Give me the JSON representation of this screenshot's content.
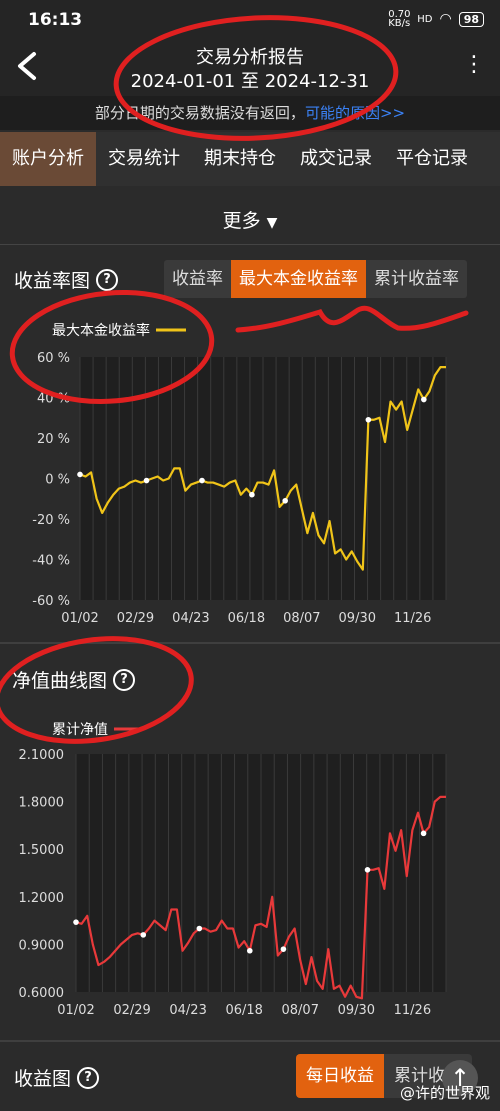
{
  "status": {
    "time": "16:13",
    "net": "0.70 KB/s",
    "signal": "HD",
    "battery": "98"
  },
  "header": {
    "title": "交易分析报告",
    "subtitle": "2024-01-01 至 2024-12-31"
  },
  "notice": {
    "text_before": "部分日期的交易数据没有返回，",
    "link": "可能的原因>>"
  },
  "tabs": [
    {
      "label": "账户分析",
      "active": true
    },
    {
      "label": "交易统计",
      "active": false
    },
    {
      "label": "期末持仓",
      "active": false
    },
    {
      "label": "成交记录",
      "active": false
    },
    {
      "label": "平仓记录",
      "active": false
    }
  ],
  "more": {
    "label": "更多"
  },
  "return_chart": {
    "title": "收益率图",
    "options": [
      {
        "label": "收益率",
        "active": false
      },
      {
        "label": "最大本金收益率",
        "active": true
      },
      {
        "label": "累计收益率",
        "active": false
      }
    ]
  },
  "nav_chart": {
    "title": "净值曲线图"
  },
  "profit_chart": {
    "title": "收益图",
    "options": [
      {
        "label": "每日收益",
        "active": true
      },
      {
        "label": "累计收益",
        "active": false
      }
    ]
  },
  "watermark": "@许的世界观",
  "chart_data": [
    {
      "type": "line",
      "title": "",
      "legend": [
        "最大本金收益率"
      ],
      "ylim": [
        -60,
        60
      ],
      "yticks": [
        "-60 %",
        "-40 %",
        "-20 %",
        "0 %",
        "20 %",
        "40 %",
        "60 %"
      ],
      "xticks": [
        "01/02",
        "02/29",
        "04/23",
        "06/18",
        "08/07",
        "09/30",
        "11/26"
      ],
      "color": "#f0c419",
      "series": [
        {
          "name": "最大本金收益率",
          "values": [
            2,
            1,
            3,
            -10,
            -17,
            -12,
            -8,
            -5,
            -4,
            -2,
            -1,
            -2,
            -1,
            0,
            1,
            -1,
            0,
            5,
            5,
            -6,
            -3,
            -2,
            -1,
            -2,
            -2,
            -3,
            -4,
            -2,
            -1,
            -8,
            -5,
            -8,
            -2,
            -2,
            -3,
            4,
            -14,
            -11,
            -6,
            -3,
            -15,
            -27,
            -17,
            -28,
            -32,
            -21,
            -37,
            -35,
            -40,
            -36,
            -41,
            -45,
            29,
            29,
            30,
            18,
            38,
            34,
            38,
            24,
            34,
            44,
            39,
            43,
            51,
            55,
            55
          ]
        }
      ]
    },
    {
      "type": "line",
      "title": "",
      "legend": [
        "累计净值"
      ],
      "ylim": [
        0.6,
        2.1
      ],
      "yticks": [
        "0.6000",
        "0.9000",
        "1.2000",
        "1.5000",
        "1.8000",
        "2.1000"
      ],
      "xticks": [
        "01/02",
        "02/29",
        "04/23",
        "06/18",
        "08/07",
        "09/30",
        "11/26"
      ],
      "color": "#e8393a",
      "series": [
        {
          "name": "累计净值",
          "values": [
            1.04,
            1.03,
            1.08,
            0.9,
            0.77,
            0.79,
            0.82,
            0.86,
            0.9,
            0.93,
            0.96,
            0.97,
            0.96,
            1.0,
            1.05,
            1.02,
            0.99,
            1.12,
            1.12,
            0.86,
            0.91,
            0.97,
            1.0,
            1.0,
            0.98,
            0.99,
            1.05,
            1.0,
            1.0,
            0.88,
            0.92,
            0.86,
            1.02,
            1.03,
            1.01,
            1.2,
            0.83,
            0.87,
            0.95,
            1.0,
            0.8,
            0.65,
            0.82,
            0.67,
            0.62,
            0.87,
            0.62,
            0.64,
            0.57,
            0.64,
            0.57,
            0.56,
            1.37,
            1.37,
            1.38,
            1.25,
            1.6,
            1.49,
            1.62,
            1.33,
            1.62,
            1.73,
            1.6,
            1.64,
            1.8,
            1.83,
            1.83
          ]
        }
      ]
    }
  ]
}
